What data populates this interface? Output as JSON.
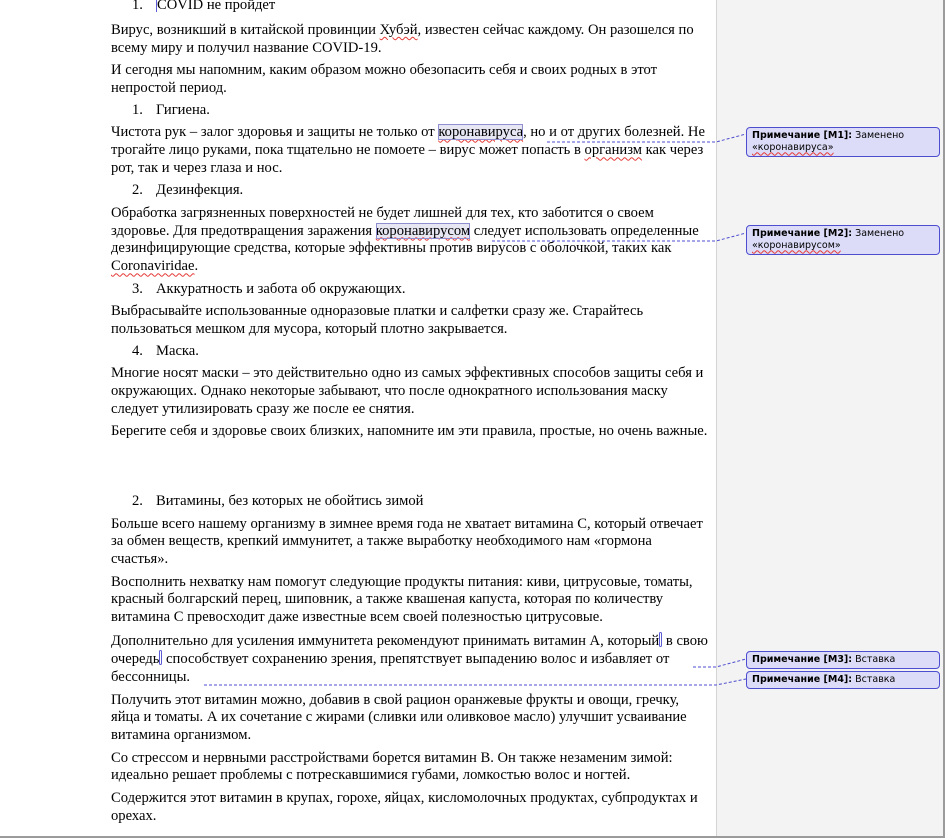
{
  "document": {
    "list1": {
      "num": "1.",
      "text": "COVID не пройдет"
    },
    "p1_a": "Вирус, возникший в китайской провинции ",
    "p1_hubei": "Хубэй",
    "p1_b": ", известен сейчас каждому. Он разошелся по всему миру и получил название COVID-19.",
    "p2": "И сегодня  мы напомним, каким  образом можно обезопасить себя и своих родных в этот непростой период.",
    "list_hyg": {
      "num": "1.",
      "text": "Гигиена."
    },
    "p3_a": "Чистота рук – залог здоровья и защиты не только от ",
    "p3_corona": "коронавируса",
    "p3_b": ", но и от других болезней. Не трогайте лицо руками, пока тщательно не помоете – вирус может попасть в ",
    "p3_org": "организм",
    "p3_c": " как через рот, так и через глаза и нос.",
    "list_dez": {
      "num": "2.",
      "text": "Дезинфекция."
    },
    "p4_a": "Обработка загрязненных поверхностей не будет лишней для тех, кто заботится о своем здоровье. Для предотвращения заражения ",
    "p4_corona": "коронавирусом",
    "p4_b": " следует использовать определенные дезинфицирующие средства, которые эффективны против вирусов с оболочкой, таких как ",
    "p4_cv": "Coronaviridae",
    "p4_c": ".",
    "list_care": {
      "num": "3.",
      "text": "Аккуратность и забота об окружающих."
    },
    "p5": "Выбрасывайте использованные одноразовые платки и салфетки сразу же. Старайтесь пользоваться мешком для мусора, который плотно закрывается.",
    "list_mask": {
      "num": "4.",
      "text": "Маска."
    },
    "p6": "Многие  носят маски – это действительно одно из самых эффективных  способов защиты себя и окружающих. Однако некоторые забывают, что после однократного использования маску следует утилизировать сразу же после ее снятия.",
    "p7": "Берегите себя и здоровье своих близких, напомните им эти правила, простые, но очень важные.",
    "list_vit": {
      "num": "2.",
      "text": "Витамины, без которых не обойтись зимой"
    },
    "p8": "Больше всего нашему организму в зимнее время года не хватает витамина С, который отвечает за обмен веществ, крепкий иммунитет, а также выработку необходимого нам «гормона счастья».",
    "p9": "Восполнить нехватку нам помогут следующие продукты питания: киви,  цитрусовые, томаты, красный болгарский перец, шиповник, а также квашеная капуста, которая по количеству витамина С превосходит даже известные всем своей полезностью цитрусовые.",
    "p10_a": "Дополнительно для усиления иммунитета рекомендуют принимать витамин А, который",
    "p10_b": " в свою очередь",
    "p10_c": " способствует сохранению зрения, препятствует выпадению волос и избавляет от бессонницы.",
    "p11": "Получить этот витамин можно, добавив в свой рацион оранжевые фрукты и овощи, гречку, яйца и томаты. А их сочетание с жирами (сливки или оливковое масло) улучшит усваивание витамина организмом.",
    "p12": "Со стрессом и нервными расстройствами борется витамин В. Он также  незаменим зимой: идеально решает проблемы с потрескавшимися губами, ломкостью волос и ногтей.",
    "p13": "Содержится этот витамин в крупах, горохе, яйцах, кисломолочных продуктах, субпродуктах и орехах."
  },
  "comments": [
    {
      "title": "Примечание [M1]:",
      "text_a": " Заменено ",
      "word": "«коронавируса»"
    },
    {
      "title": "Примечание [M2]:",
      "text_a": " Заменено ",
      "word": "«коронавирусом»"
    },
    {
      "title": "Примечание [M3]:",
      "text_a": " Вставка",
      "word": ""
    },
    {
      "title": "Примечание [M4]:",
      "text_a": " Вставка",
      "word": ""
    }
  ],
  "colors": {
    "comment_fill": "#dcdcf8",
    "comment_border": "#4d4dd0",
    "spell_error": "#e53935",
    "markup_pane": "#f3f3f3"
  }
}
